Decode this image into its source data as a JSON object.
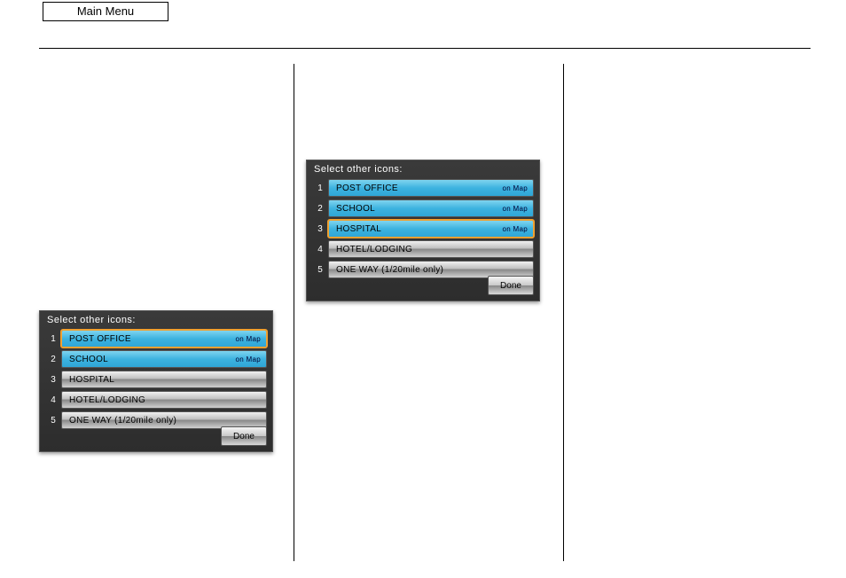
{
  "tab_label": "Main Menu",
  "screen_a": {
    "title": "Select other icons:",
    "rows": [
      {
        "num": "1",
        "label": "POST OFFICE",
        "status": "on Map",
        "selected": true,
        "highlight": true
      },
      {
        "num": "2",
        "label": "SCHOOL",
        "status": "on Map",
        "selected": true,
        "highlight": false
      },
      {
        "num": "3",
        "label": "HOSPITAL",
        "status": "",
        "selected": false,
        "highlight": false
      },
      {
        "num": "4",
        "label": "HOTEL/LODGING",
        "status": "",
        "selected": false,
        "highlight": false
      },
      {
        "num": "5",
        "label": "ONE WAY (1/20mile only)",
        "status": "",
        "selected": false,
        "highlight": false
      }
    ],
    "done": "Done"
  },
  "screen_b": {
    "title": "Select other icons:",
    "rows": [
      {
        "num": "1",
        "label": "POST OFFICE",
        "status": "on Map",
        "selected": true,
        "highlight": false
      },
      {
        "num": "2",
        "label": "SCHOOL",
        "status": "on Map",
        "selected": true,
        "highlight": false
      },
      {
        "num": "3",
        "label": "HOSPITAL",
        "status": "on Map",
        "selected": true,
        "highlight": true
      },
      {
        "num": "4",
        "label": "HOTEL/LODGING",
        "status": "",
        "selected": false,
        "highlight": false
      },
      {
        "num": "5",
        "label": "ONE WAY (1/20mile only)",
        "status": "",
        "selected": false,
        "highlight": false
      }
    ],
    "done": "Done"
  }
}
